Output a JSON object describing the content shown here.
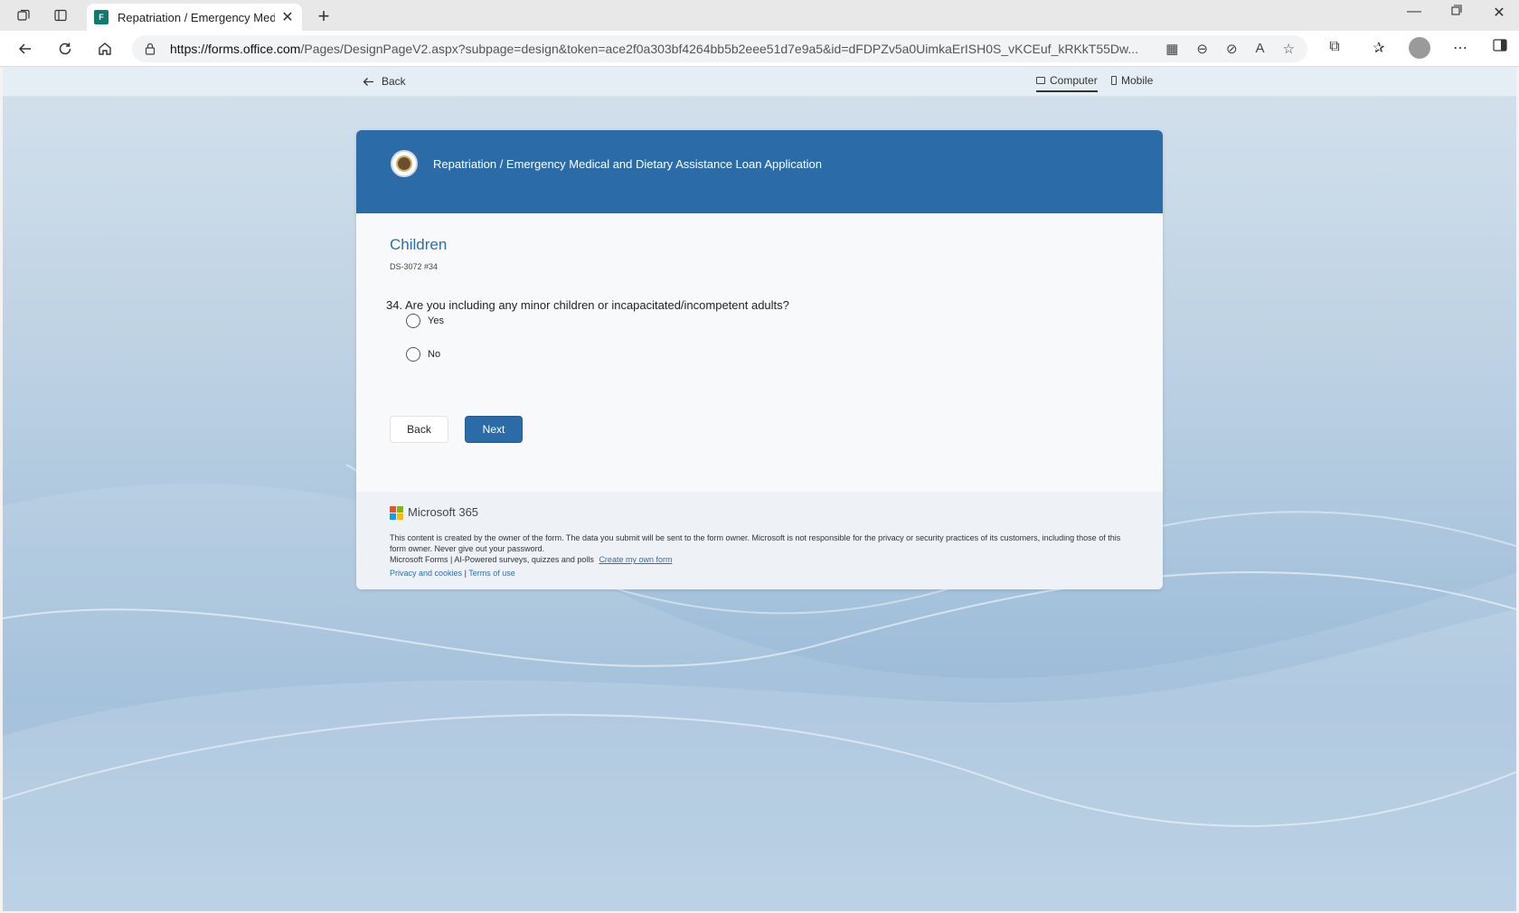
{
  "browser": {
    "tab_title": "Repatriation / Emergency Medical and Dietary Assistance Loan Application",
    "tab_favicon_text": "F",
    "url_domain": "https://forms.office.com",
    "url_path": "/Pages/DesignPageV2.aspx?subpage=design&token=ace2f0a303bf4264bb5b2eee51d7e9a5&id=dFDPZv5a0UimkaErISH0S_vKCEuf_kRKkT55Dw..."
  },
  "toolbar": {
    "back_label": "Back",
    "computer_label": "Computer",
    "mobile_label": "Mobile"
  },
  "form": {
    "title": "Repatriation / Emergency Medical and Dietary Assistance Loan Application",
    "section_title": "Children",
    "section_subtitle": "DS-3072 #34",
    "question_number": "34.",
    "question_text": "Are you including any minor children or incapacitated/incompetent adults?",
    "options": [
      "Yes",
      "No"
    ],
    "back_button": "Back",
    "next_button": "Next"
  },
  "footer": {
    "brand": "Microsoft 365",
    "disclaimer": "This content is created by the owner of the form. The data you submit will be sent to the form owner. Microsoft is not responsible for the privacy or security practices of its customers, including those of this form owner. Never give out your password.",
    "tagline": "Microsoft Forms | AI-Powered surveys, quizzes and polls",
    "create_link": "Create my own form",
    "privacy_link": "Privacy and cookies",
    "separator": "|",
    "terms_link": "Terms of use"
  },
  "colors": {
    "banner": "#2b6ca8",
    "accent": "#2f6ea6",
    "next_button": "#2b6ca8"
  }
}
